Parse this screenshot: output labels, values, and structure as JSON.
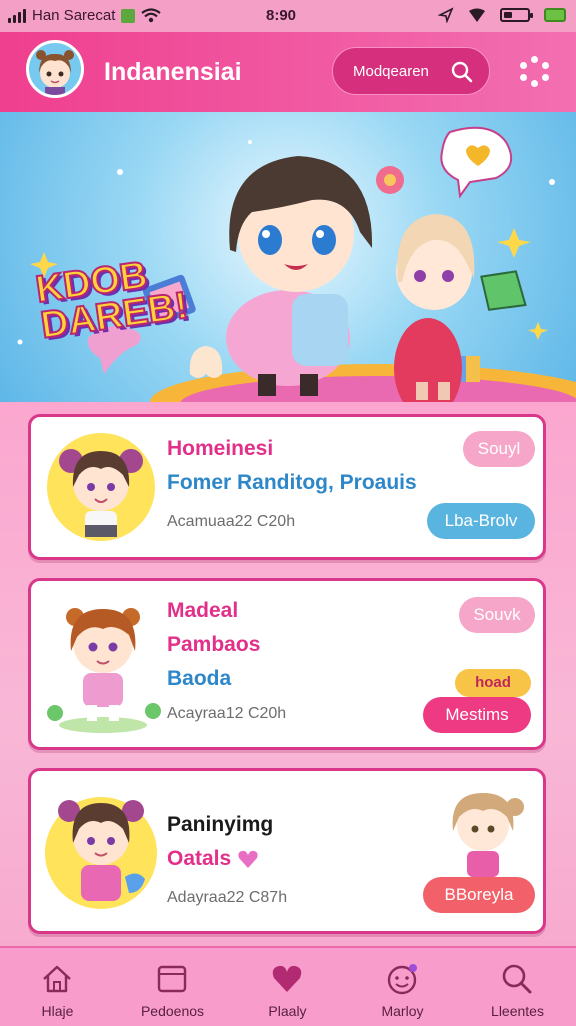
{
  "status": {
    "carrier": "Han Sarecat",
    "time": "8:90"
  },
  "header": {
    "title": "Indanensiai",
    "search_label": "Modqearen"
  },
  "banner": {
    "line1": "KDOB",
    "line2": "DAREB!"
  },
  "cards": [
    {
      "title": "Homeinesi",
      "line2": "Fomer Randitog, Proauis",
      "meta": "Acamuaa22 C20h",
      "top_pill": "Souyl",
      "bottom_pill": "Lba-Brolv"
    },
    {
      "title": "Madeal",
      "line2": "Pambaos",
      "line3": "Baoda",
      "meta": "Acayraa12 C20h",
      "top_pill": "Souvk",
      "tag": "hoad",
      "bottom_pill": "Mestims"
    },
    {
      "title": "Paninyimg",
      "line2": "Oatals",
      "meta": "Adayraa22 C87h",
      "bottom_pill": "BBoreyla"
    }
  ],
  "nav": [
    {
      "label": "Hlaje",
      "icon": "home-icon"
    },
    {
      "label": "Pedoenos",
      "icon": "library-icon"
    },
    {
      "label": "Plaaly",
      "icon": "heart-icon"
    },
    {
      "label": "Marloy",
      "icon": "profile-icon"
    },
    {
      "label": "Lleentes",
      "icon": "search-icon"
    }
  ],
  "colors": {
    "accent": "#d8378a",
    "header": "#ef3f8f",
    "blue": "#5ab4e0",
    "pink_pill": "#ee3a82",
    "coral_pill": "#f2616a"
  }
}
